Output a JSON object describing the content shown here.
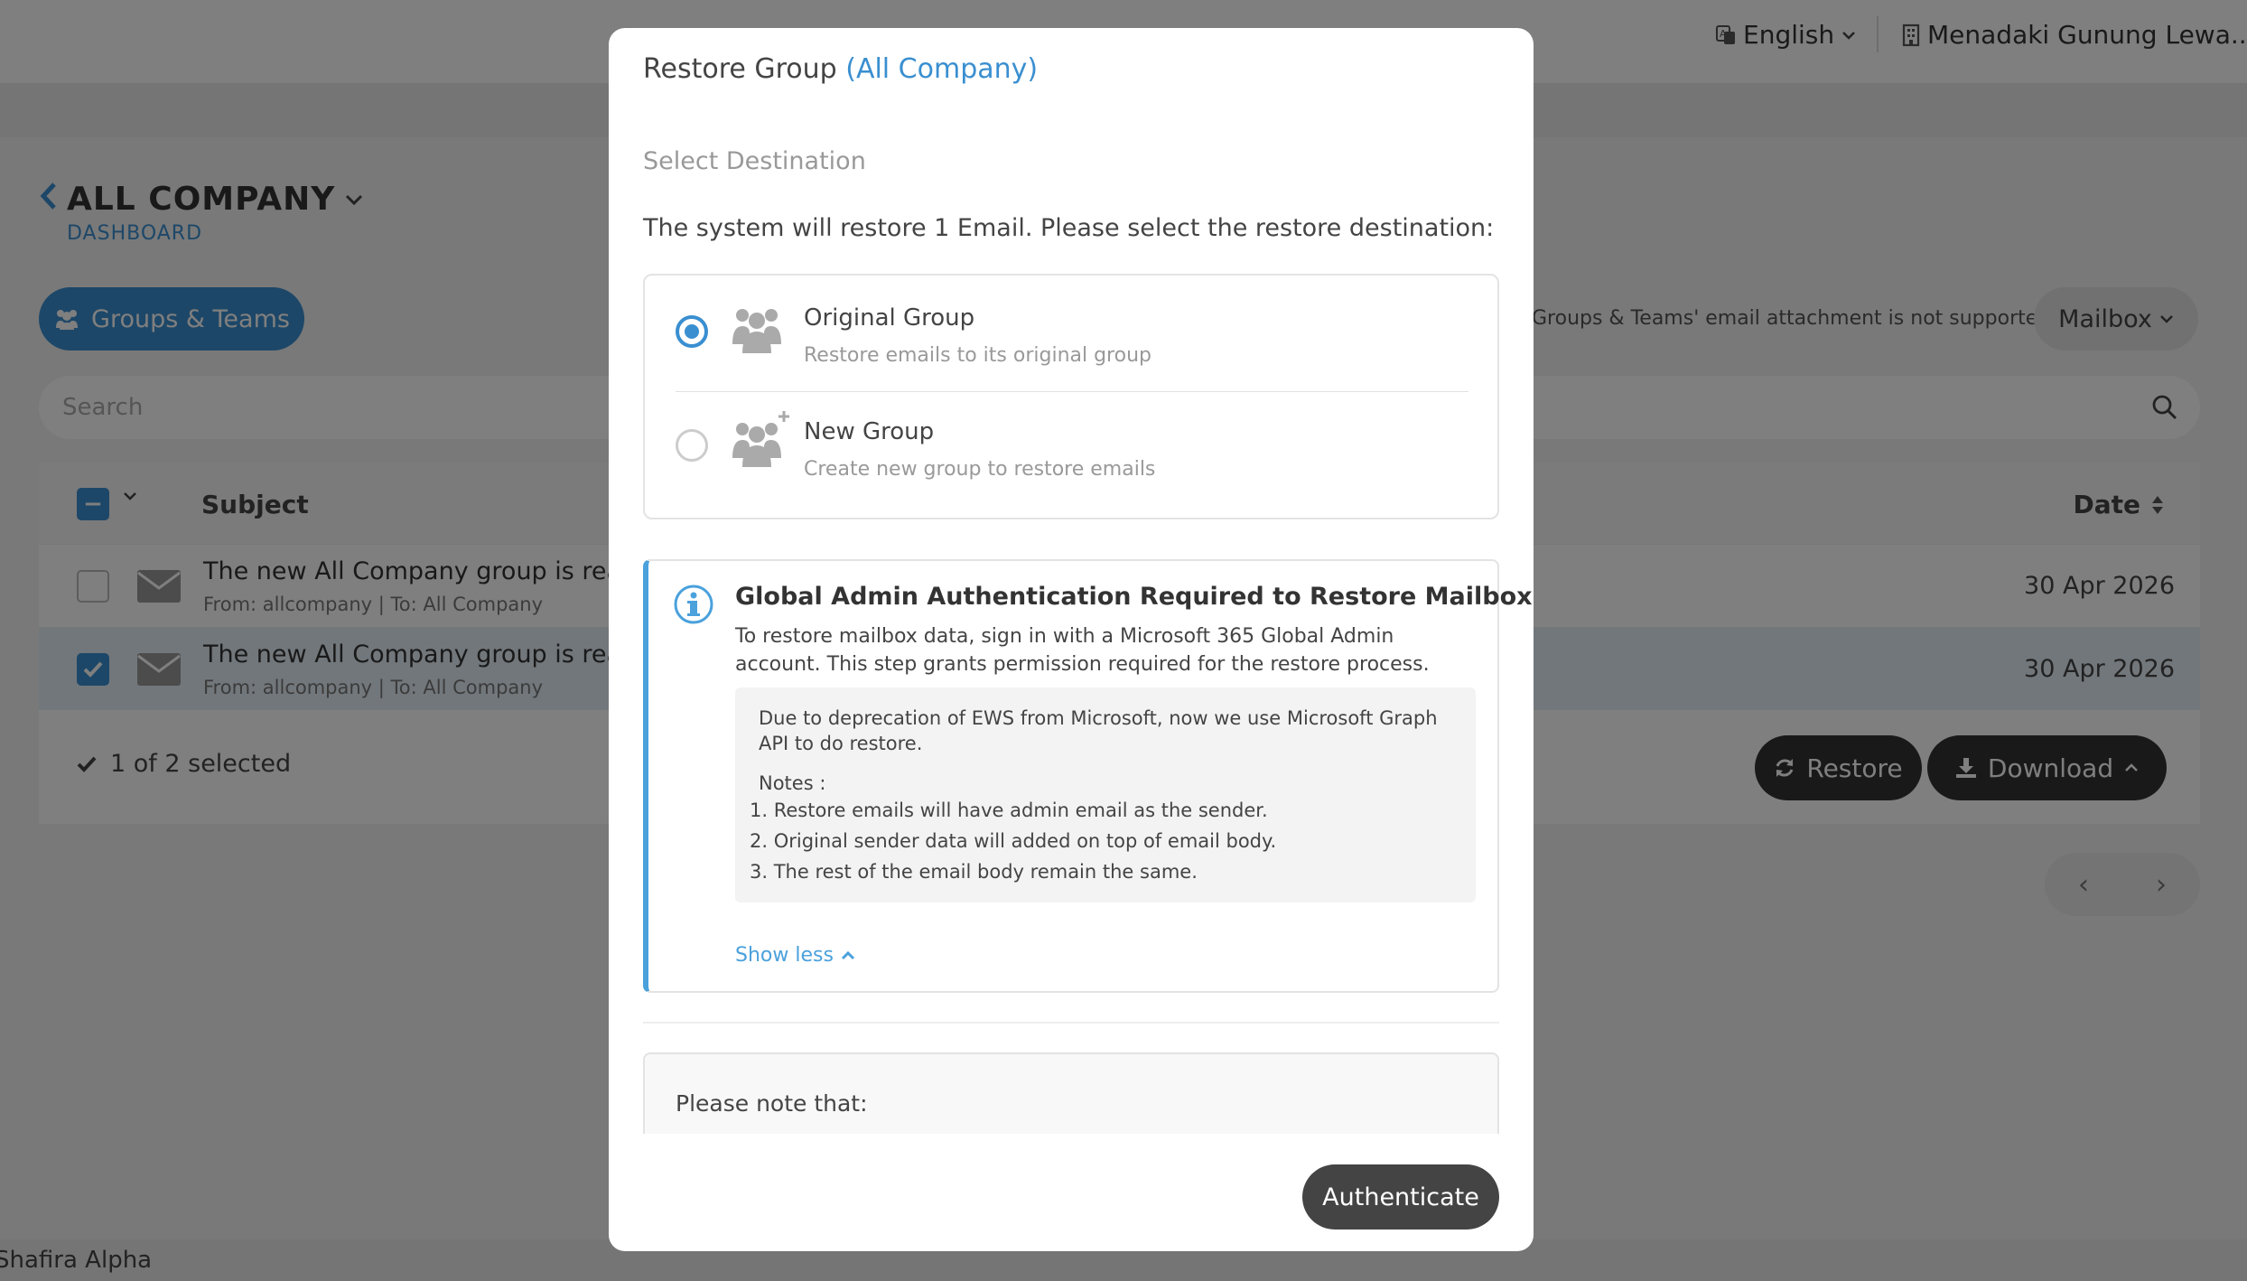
{
  "topbar": {
    "language": "English",
    "organization": "Menadaki Gunung Lewa..."
  },
  "page": {
    "title": "ALL COMPANY",
    "breadcrumb": "DASHBOARD"
  },
  "toolbar": {
    "groups_label": "Groups & Teams",
    "notice": "Groups & Teams' email attachment is not supported.",
    "mailbox_label": "Mailbox"
  },
  "search": {
    "placeholder": "Search"
  },
  "table": {
    "header_subject": "Subject",
    "header_date": "Date",
    "rows": [
      {
        "subject": "The new All Company group is ready",
        "from": "From: allcompany | To: All Company",
        "date": "30 Apr 2026",
        "selected": false
      },
      {
        "subject": "The new All Company group is ready",
        "from": "From: allcompany | To: All Company",
        "date": "30 Apr 2026",
        "selected": true
      }
    ]
  },
  "selection": {
    "count_text": "1 of 2 selected",
    "restore_label": "Restore",
    "download_label": "Download"
  },
  "footer": {
    "user": "Shafira Alpha"
  },
  "modal": {
    "title": "Restore Group",
    "title_accent": "(All Company)",
    "subtitle": "Select Destination",
    "description": "The system will restore 1 Email. Please select the restore destination:",
    "options": [
      {
        "title": "Original Group",
        "desc": "Restore emails to its original group",
        "checked": true
      },
      {
        "title": "New Group",
        "desc": "Create new group to restore emails",
        "checked": false
      }
    ],
    "auth": {
      "title": "Global Admin Authentication Required to Restore Mailbox",
      "text": "To restore mailbox data, sign in with a Microsoft 365 Global Admin account. This step grants permission required for the restore process.",
      "note_lead": "Due to deprecation of EWS from Microsoft, now we use Microsoft Graph API to do restore.",
      "notes_label": "Notes :",
      "notes": [
        "1. Restore emails will have admin email as the sender.",
        "2. Original sender data will added on top of email body.",
        "3. The rest of the email body remain the same."
      ],
      "show_less": "Show less"
    },
    "please_note": "Please note that:",
    "authenticate_label": "Authenticate"
  },
  "colors": {
    "accent": "#3a8fd0",
    "info_border": "#4aa1dc",
    "dark_button": "#333333"
  }
}
